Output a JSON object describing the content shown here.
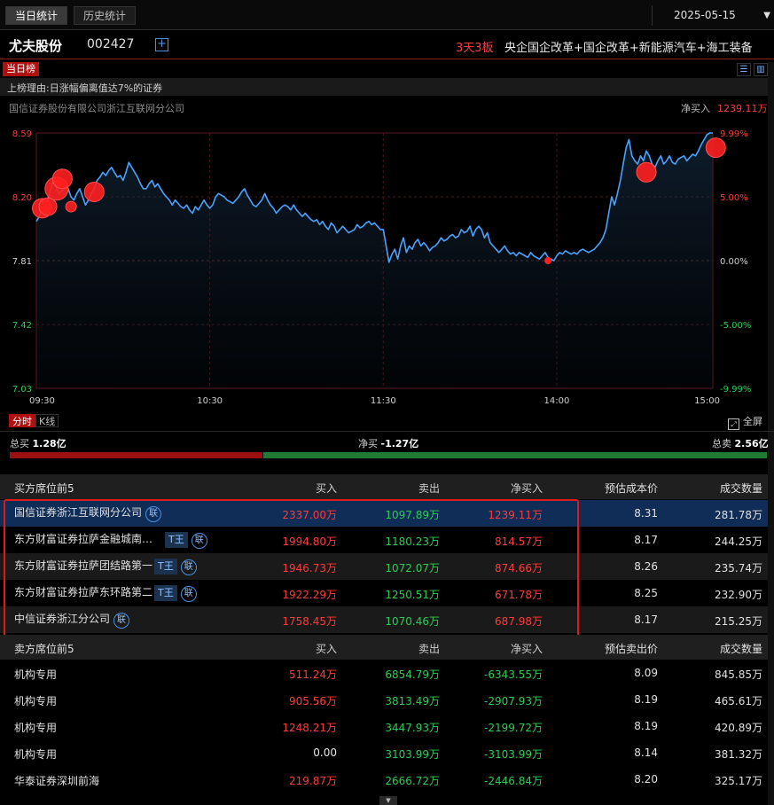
{
  "tabs": {
    "today": "当日统计",
    "history": "历史统计"
  },
  "date": "2025-05-15",
  "stock": {
    "name": "尤夫股份",
    "code": "002427",
    "add_symbol": "+",
    "board": "3天3板",
    "concepts": "央企国企改革+国企改革+新能源汽车+海工装备"
  },
  "list_tab": "当日榜",
  "reason": "上榜理由:日涨幅偏离值达7%的证券",
  "broker_title": "国信证券股份有限公司浙江互联网分公司",
  "net_buy_label": "净买入",
  "net_buy_value": "1239.11万",
  "chart_data": {
    "type": "line",
    "y_labels_left": [
      "8.59",
      "8.20",
      "7.81",
      "7.42",
      "7.03"
    ],
    "y_labels_right": [
      "9.99%",
      "5.00%",
      "0.00%",
      "-5.00%",
      "-9.99%"
    ],
    "ylim": [
      7.03,
      8.59
    ],
    "base_price": 7.81,
    "x_ticks": [
      "09:30",
      "10:30",
      "11:30",
      "14:00",
      "15:00"
    ],
    "x_tick_index": [
      0,
      60,
      120,
      180,
      240
    ],
    "prices": [
      8.05,
      8.08,
      8.15,
      8.12,
      8.18,
      8.25,
      8.3,
      8.25,
      8.22,
      8.24,
      8.27,
      8.25,
      8.2,
      8.18,
      8.22,
      8.25,
      8.2,
      8.15,
      8.18,
      8.22,
      8.25,
      8.3,
      8.32,
      8.35,
      8.33,
      8.36,
      8.38,
      8.35,
      8.32,
      8.33,
      8.3,
      8.35,
      8.41,
      8.38,
      8.35,
      8.32,
      8.28,
      8.25,
      8.25,
      8.28,
      8.3,
      8.26,
      8.28,
      8.25,
      8.22,
      8.2,
      8.18,
      8.15,
      8.18,
      8.16,
      8.14,
      8.13,
      8.15,
      8.12,
      8.1,
      8.14,
      8.12,
      8.15,
      8.18,
      8.15,
      8.13,
      8.15,
      8.2,
      8.22,
      8.21,
      8.2,
      8.18,
      8.17,
      8.16,
      8.18,
      8.2,
      8.23,
      8.25,
      8.21,
      8.18,
      8.15,
      8.14,
      8.16,
      8.18,
      8.22,
      8.18,
      8.15,
      8.13,
      8.1,
      8.12,
      8.14,
      8.15,
      8.14,
      8.12,
      8.15,
      8.12,
      8.1,
      8.08,
      8.1,
      8.08,
      8.06,
      8.05,
      8.06,
      8.03,
      8.05,
      8.02,
      8.0,
      8.04,
      8.02,
      7.98,
      8.0,
      8.02,
      8.0,
      7.98,
      7.99,
      8.0,
      8.03,
      8.01,
      8.02,
      8.04,
      8.05,
      8.03,
      8.04,
      8.02,
      8.0,
      8.0,
      7.9,
      7.8,
      7.85,
      7.88,
      7.82,
      7.9,
      7.95,
      7.86,
      7.9,
      7.88,
      7.92,
      7.94,
      7.9,
      7.92,
      7.9,
      7.87,
      7.89,
      7.9,
      7.92,
      7.95,
      7.93,
      7.94,
      7.96,
      7.97,
      7.95,
      7.96,
      8.0,
      7.98,
      7.99,
      8.02,
      7.96,
      8.0,
      8.02,
      8.0,
      7.95,
      7.98,
      7.92,
      7.9,
      7.88,
      7.86,
      7.88,
      7.9,
      7.87,
      7.85,
      7.86,
      7.84,
      7.86,
      7.85,
      7.84,
      7.83,
      7.86,
      7.84,
      7.83,
      7.82,
      7.84,
      7.86,
      7.83,
      7.82,
      7.81,
      7.84,
      7.86,
      7.85,
      7.87,
      7.86,
      7.85,
      7.86,
      7.85,
      7.87,
      7.88,
      7.87,
      7.86,
      7.87,
      7.88,
      7.9,
      7.92,
      7.95,
      8.0,
      8.1,
      8.2,
      8.15,
      8.22,
      8.3,
      8.4,
      8.5,
      8.55,
      8.45,
      8.42,
      8.4,
      8.45,
      8.42,
      8.48,
      8.45,
      8.4,
      8.38,
      8.42,
      8.45,
      8.4,
      8.42,
      8.45,
      8.41,
      8.4,
      8.43,
      8.44,
      8.45,
      8.42,
      8.44,
      8.46,
      8.45,
      8.48,
      8.52,
      8.55,
      8.58,
      8.59,
      8.59
    ],
    "bubbles_red": [
      {
        "i": 2,
        "p": 8.13,
        "r": 11
      },
      {
        "i": 4,
        "p": 8.14,
        "r": 10
      },
      {
        "i": 7,
        "p": 8.25,
        "r": 13
      },
      {
        "i": 9,
        "p": 8.31,
        "r": 11
      },
      {
        "i": 12,
        "p": 8.14,
        "r": 6
      },
      {
        "i": 20,
        "p": 8.23,
        "r": 11
      },
      {
        "i": 211,
        "p": 8.35,
        "r": 11
      },
      {
        "i": 235,
        "p": 8.5,
        "r": 11
      }
    ],
    "bubbles_small": [
      {
        "i": 177,
        "p": 7.81,
        "r": 4
      }
    ]
  },
  "chart_tabs": {
    "timeshare": "分时",
    "kline": "K线"
  },
  "fullscreen": "全屏",
  "totals": {
    "buy_label": "总买",
    "buy_value": "1.28亿",
    "net_label": "净买",
    "net_value": "-1.27亿",
    "sell_label": "总卖",
    "sell_value": "2.56亿"
  },
  "buy_table": {
    "headers": [
      "买方席位前5",
      "买入",
      "卖出",
      "净买入",
      "预估成本价",
      "成交数量"
    ],
    "rows": [
      {
        "name": "国信证券浙江互联网分公司",
        "t": "",
        "l": "联",
        "buy": "2337.00万",
        "sell": "1097.89万",
        "net": "1239.11万",
        "cost": "8.31",
        "vol": "281.78万"
      },
      {
        "name": "东方财富证券拉萨金融城南…",
        "t": "T王",
        "l": "联",
        "buy": "1994.80万",
        "sell": "1180.23万",
        "net": "814.57万",
        "cost": "8.17",
        "vol": "244.25万"
      },
      {
        "name": "东方财富证券拉萨团结路第一",
        "t": "T王",
        "l": "联",
        "buy": "1946.73万",
        "sell": "1072.07万",
        "net": "874.66万",
        "cost": "8.26",
        "vol": "235.74万"
      },
      {
        "name": "东方财富证券拉萨东环路第二",
        "t": "T王",
        "l": "联",
        "buy": "1922.29万",
        "sell": "1250.51万",
        "net": "671.78万",
        "cost": "8.25",
        "vol": "232.90万"
      },
      {
        "name": "中信证券浙江分公司",
        "t": "",
        "l": "联",
        "buy": "1758.45万",
        "sell": "1070.46万",
        "net": "687.98万",
        "cost": "8.17",
        "vol": "215.25万"
      }
    ]
  },
  "sell_table": {
    "headers": [
      "卖方席位前5",
      "买入",
      "卖出",
      "净买入",
      "预估卖出价",
      "成交数量"
    ],
    "rows": [
      {
        "name": "机构专用",
        "buy": "511.24万",
        "sell": "6854.79万",
        "net": "-6343.55万",
        "cost": "8.09",
        "vol": "845.85万"
      },
      {
        "name": "机构专用",
        "buy": "905.56万",
        "sell": "3813.49万",
        "net": "-2907.93万",
        "cost": "8.19",
        "vol": "465.61万"
      },
      {
        "name": "机构专用",
        "buy": "1248.21万",
        "sell": "3447.93万",
        "net": "-2199.72万",
        "cost": "8.19",
        "vol": "420.89万"
      },
      {
        "name": "机构专用",
        "buy": "0.00",
        "sell": "3103.99万",
        "net": "-3103.99万",
        "cost": "8.14",
        "vol": "381.32万"
      },
      {
        "name": "华泰证券深圳前海",
        "buy": "219.87万",
        "sell": "2666.72万",
        "net": "-2446.84万",
        "cost": "8.20",
        "vol": "325.17万"
      }
    ]
  },
  "colors": {
    "up": "#ff3b3b",
    "down": "#2ecc55",
    "line": "#4aa3ff",
    "grid": "#5a1a1a",
    "selected": "#0f2d57"
  }
}
